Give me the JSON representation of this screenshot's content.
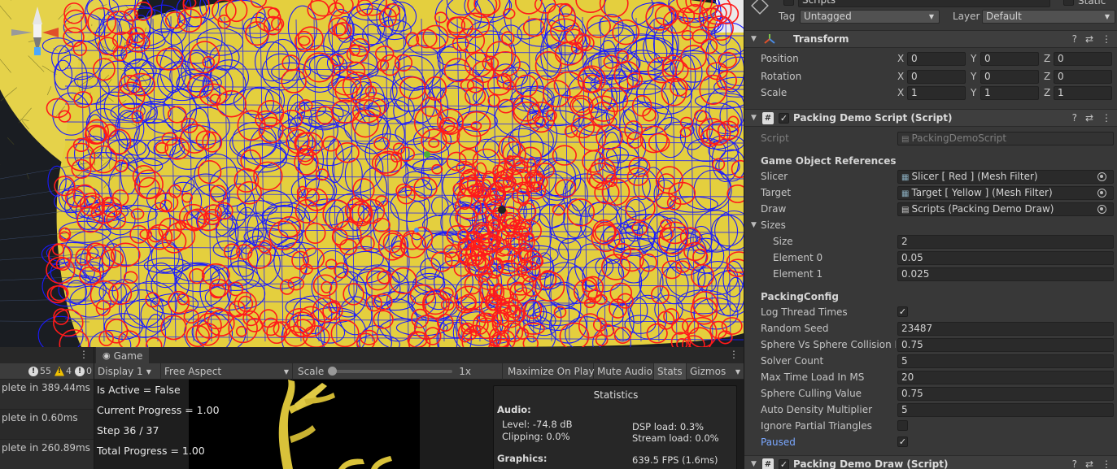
{
  "console": {
    "counts": {
      "info": "55",
      "warn": "4",
      "error": "0"
    },
    "rows": [
      "plete in 389.44ms",
      "plete in 0.60ms",
      "plete in 260.89ms"
    ]
  },
  "game": {
    "tab_label": "Game",
    "display": "Display 1",
    "aspect": "Free Aspect",
    "scale_label": "Scale",
    "scale_value": "1x",
    "maximize": "Maximize On Play",
    "mute": "Mute Audio",
    "stats": "Stats",
    "gizmos": "Gizmos",
    "gui": [
      "Is Active = False",
      "Current Progress = 1.00",
      "Step 36 / 37",
      "Total Progress = 1.00"
    ],
    "statistics": {
      "title": "Statistics",
      "audio_header": "Audio:",
      "level": "Level: -74.8 dB",
      "clipping": "Clipping: 0.0%",
      "dsp": "DSP load: 0.3%",
      "stream": "Stream load: 0.0%",
      "graphics_header": "Graphics:",
      "fps": "639.5 FPS (1.6ms)"
    }
  },
  "inspector": {
    "object_name": "Scripts",
    "static_label": "Static",
    "tag_label": "Tag",
    "tag_value": "Untagged",
    "layer_label": "Layer",
    "layer_value": "Default",
    "transform": {
      "title": "Transform",
      "position_label": "Position",
      "rotation_label": "Rotation",
      "scale_label": "Scale",
      "position": [
        "0",
        "0",
        "0"
      ],
      "rotation": [
        "0",
        "0",
        "0"
      ],
      "scale": [
        "1",
        "1",
        "1"
      ],
      "axes": [
        "X",
        "Y",
        "Z"
      ]
    },
    "packing": {
      "title": "Packing Demo Script (Script)",
      "script_label": "Script",
      "script_value": "PackingDemoScript",
      "refs_header": "Game Object References",
      "slicer_label": "Slicer",
      "slicer_value": "Slicer [ Red ] (Mesh Filter)",
      "target_label": "Target",
      "target_value": "Target [ Yellow ] (Mesh Filter)",
      "draw_label": "Draw",
      "draw_value": "Scripts (Packing Demo Draw)",
      "sizes_label": "Sizes",
      "size_label": "Size",
      "size_value": "2",
      "el0_label": "Element 0",
      "el0_value": "0.05",
      "el1_label": "Element 1",
      "el1_value": "0.025",
      "config_header": "PackingConfig",
      "log_label": "Log Thread Times",
      "seed_label": "Random Seed",
      "seed_value": "23487",
      "collision_label": "Sphere Vs Sphere Collision Ra",
      "collision_value": "0.75",
      "solver_label": "Solver Count",
      "solver_value": "5",
      "maxtime_label": "Max Time Load In MS",
      "maxtime_value": "20",
      "culling_label": "Sphere Culling Value",
      "culling_value": "0.75",
      "density_label": "Auto Density Multiplier",
      "density_value": "5",
      "ignore_label": "Ignore Partial Triangles",
      "paused_label": "Paused"
    },
    "draw_component": {
      "title": "Packing Demo Draw (Script)"
    }
  },
  "colors": {
    "accent_blue": "#7aa7ff",
    "slicer_red": "#ff1a1a",
    "target_yellow": "#e8d23a",
    "circle_blue": "#1a1aff"
  }
}
